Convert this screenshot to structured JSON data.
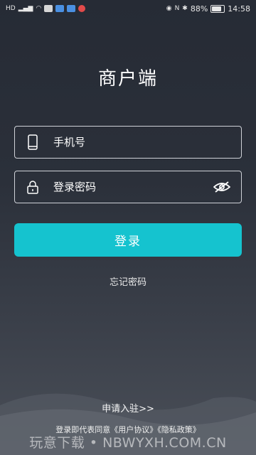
{
  "statusbar": {
    "battery": "88%",
    "battery_level": 0.88,
    "time": "14:58",
    "left_icons": [
      "hd-icon",
      "signal-icon",
      "wifi-icon",
      "message-icon",
      "mail-icon",
      "app-icon",
      "notification-icon"
    ],
    "right_icons": [
      "eye-icon",
      "nfc-icon",
      "bluetooth-icon",
      "battery-icon"
    ]
  },
  "app": {
    "title": "商户端"
  },
  "form": {
    "phone_placeholder": "手机号",
    "password_placeholder": "登录密码",
    "login_label": "登录",
    "forgot_label": "忘记密码"
  },
  "footer": {
    "apply_label": "申请入驻>>",
    "agreement_prefix": "登录即代表同意",
    "user_agreement": "《用户协议》",
    "privacy_policy": "《隐私政策》",
    "watermark": "玩意下载 • NBWYXH.COM.CN"
  },
  "colors": {
    "accent": "#15c3cf",
    "background": "#2b303a"
  }
}
